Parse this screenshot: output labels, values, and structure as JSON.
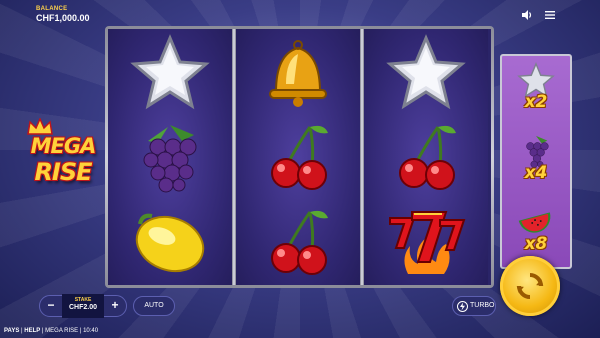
{
  "header": {
    "balance_label": "BALANCE",
    "balance_value": "CHF1,000.00",
    "sound_icon": "speaker-icon",
    "menu_icon": "hamburger-menu-icon"
  },
  "logo": {
    "line1": "MEGA",
    "line2": "RISE",
    "crown_icon": "crown-icon"
  },
  "reels": [
    [
      "silver-star",
      "grapes",
      "lemon"
    ],
    [
      "golden-bell",
      "cherries",
      "cherries"
    ],
    [
      "silver-star",
      "cherries",
      "flaming-sevens"
    ]
  ],
  "multipliers": [
    {
      "symbol": "silver-star",
      "label": "x2"
    },
    {
      "symbol": "grapes",
      "label": "x4"
    },
    {
      "symbol": "watermelon",
      "label": "x8"
    }
  ],
  "controls": {
    "minus_label": "−",
    "plus_label": "+",
    "stake_label": "STAKE",
    "stake_value": "CHF2.00",
    "auto_label": "AUTO",
    "turbo_label": "TURBO",
    "turbo_icon": "lightning-icon",
    "spin_icon": "spin-arrows-icon"
  },
  "footer": {
    "pays": "PAYS",
    "sep1": " | ",
    "help": "HELP",
    "sep2": " | ",
    "game": "MEGA RISE",
    "sep3": " | ",
    "time": "10:40"
  },
  "colors": {
    "accent_gold": "#ffd23a",
    "panel_purple": "#8a49b8",
    "reel_bg": "#2f2670"
  }
}
